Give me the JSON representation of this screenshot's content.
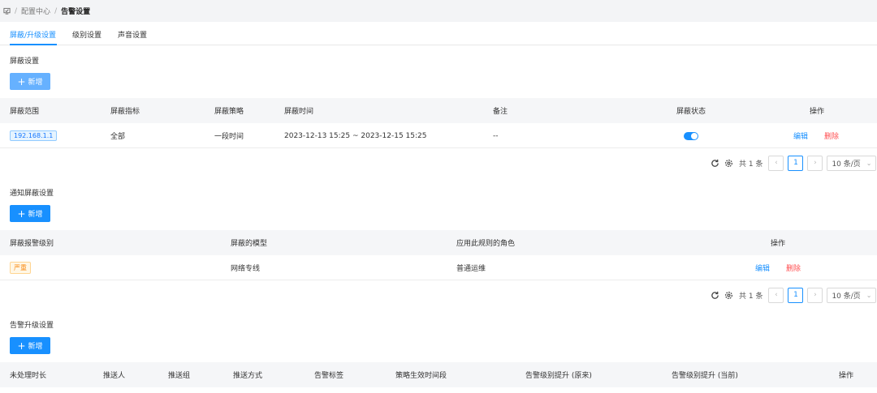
{
  "breadcrumb": {
    "home_icon": "home-icon",
    "items": [
      "配置中心",
      "告警设置"
    ]
  },
  "tabs": [
    {
      "label": "屏蔽/升级设置",
      "active": true
    },
    {
      "label": "级别设置",
      "active": false
    },
    {
      "label": "声音设置",
      "active": false
    }
  ],
  "accent": "#1890ff",
  "danger": "#ff4d4f",
  "shield": {
    "title": "屏蔽设置",
    "add_label": "新增",
    "columns": [
      "屏蔽范围",
      "屏蔽指标",
      "屏蔽策略",
      "屏蔽时间",
      "备注",
      "屏蔽状态",
      "操作"
    ],
    "rows": [
      {
        "scope": "192.168.1.1",
        "metric": "全部",
        "strategy": "一段时间",
        "time": "2023-12-13 15:25 ~ 2023-12-15 15:25",
        "note": "--",
        "enabled": true,
        "edit": "编辑",
        "delete": "删除"
      }
    ],
    "pager": {
      "total": "共 1 条",
      "page": "1",
      "size": "10 条/页"
    }
  },
  "notify": {
    "title": "通知屏蔽设置",
    "add_label": "新增",
    "columns": [
      "屏蔽报警级别",
      "屏蔽的模型",
      "应用此规则的角色",
      "操作"
    ],
    "rows": [
      {
        "level": "严重",
        "model": "网络专线",
        "role": "普通运维",
        "edit": "编辑",
        "delete": "删除"
      }
    ],
    "pager": {
      "total": "共 1 条",
      "page": "1",
      "size": "10 条/页"
    }
  },
  "upgrade": {
    "title": "告警升级设置",
    "add_label": "新增",
    "columns": [
      "未处理时长",
      "推送人",
      "推送组",
      "推送方式",
      "告警标签",
      "策略生效时间段",
      "告警级别提升 (原来)",
      "告警级别提升 (当前)",
      "操作"
    ]
  }
}
